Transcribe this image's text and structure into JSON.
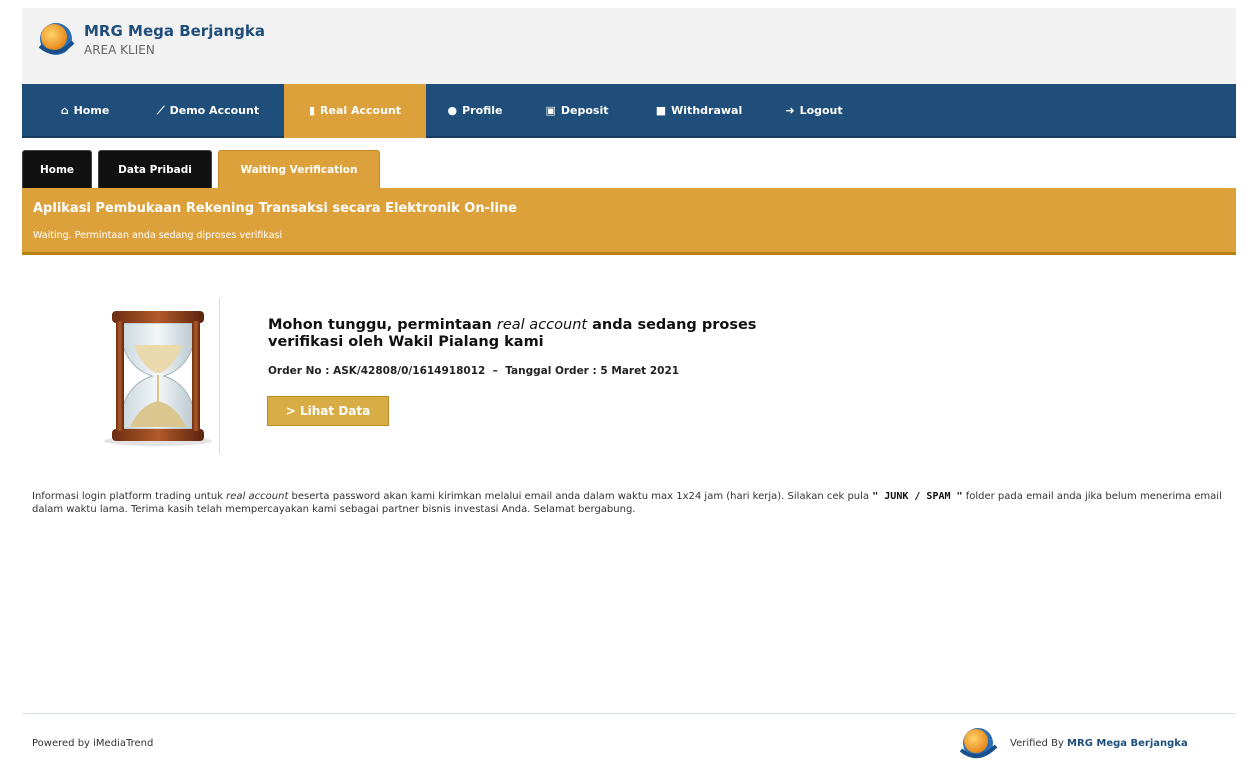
{
  "brand": {
    "name": "MRG Mega Berjangka",
    "subtitle": "AREA KLIEN"
  },
  "nav": [
    {
      "icon": "home-icon",
      "glyph": "⌂",
      "label": "Home"
    },
    {
      "icon": "chart-icon",
      "glyph": "⟋",
      "label": "Demo Account"
    },
    {
      "icon": "bar-chart-icon",
      "glyph": "▮",
      "label": "Real Account",
      "active": true
    },
    {
      "icon": "user-icon",
      "glyph": "●",
      "label": "Profile"
    },
    {
      "icon": "money-icon",
      "glyph": "▣",
      "label": "Deposit"
    },
    {
      "icon": "briefcase-icon",
      "glyph": "■",
      "label": "Withdrawal"
    },
    {
      "icon": "logout-icon",
      "glyph": "➜",
      "label": "Logout"
    }
  ],
  "tabs": [
    {
      "label": "Home"
    },
    {
      "label": "Data Pribadi"
    },
    {
      "label": "Waiting Verification",
      "active": true
    }
  ],
  "banner": {
    "title": "Aplikasi Pembukaan Rekening Transaksi secara Elektronik On-line",
    "subtitle": "Waiting. Permintaan anda sedang diproses verifikasi"
  },
  "message": {
    "line1_prefix": "Mohon tunggu, permintaan ",
    "line1_em": "real account",
    "line1_suffix": " anda sedang proses",
    "line2": "verifikasi oleh Wakil Pialang kami"
  },
  "order": {
    "no_label": "Order No :",
    "no_value": "ASK/42808/0/1614918012",
    "separator": "–",
    "date_label": "Tanggal Order :",
    "date_value": "5 Maret 2021"
  },
  "view_button": "> Lihat Data",
  "info": {
    "part1": "Informasi login platform trading untuk ",
    "em": "real account",
    "part2": " beserta password akan kami kirimkan melalui email anda dalam waktu max 1x24 jam (hari kerja). Silakan cek pula ",
    "bold": "\" JUNK / SPAM \"",
    "part3": " folder pada email anda jika belum menerima email dalam waktu lama. Terima kasih telah mempercayakan kami sebagai partner bisnis investasi Anda. Selamat bergabung."
  },
  "footer": {
    "powered": "Powered by iMediaTrend",
    "verified_prefix": "Verified By ",
    "verified_brand": "MRG Mega Berjangka"
  },
  "colors": {
    "nav_bg": "#1f4e7a",
    "accent": "#dda13b",
    "tab_bg": "#111111"
  }
}
